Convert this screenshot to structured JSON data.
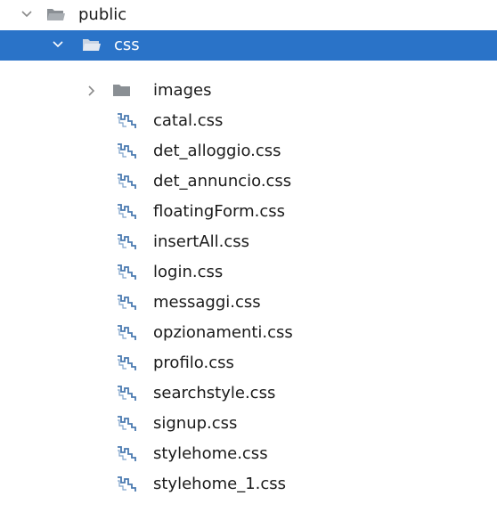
{
  "tree": {
    "public": {
      "label": "public",
      "icon": "folder-open-icon",
      "expanded": true
    },
    "css": {
      "label": "css",
      "icon": "folder-open-icon",
      "expanded": true,
      "selected": true
    },
    "images": {
      "label": "images",
      "icon": "folder-icon",
      "expanded": false
    },
    "files": [
      {
        "label": "catal.css",
        "icon": "css-file-icon"
      },
      {
        "label": "det_alloggio.css",
        "icon": "css-file-icon"
      },
      {
        "label": "det_annuncio.css",
        "icon": "css-file-icon"
      },
      {
        "label": "floatingForm.css",
        "icon": "css-file-icon"
      },
      {
        "label": "insertAll.css",
        "icon": "css-file-icon"
      },
      {
        "label": "login.css",
        "icon": "css-file-icon"
      },
      {
        "label": "messaggi.css",
        "icon": "css-file-icon"
      },
      {
        "label": "opzionamenti.css",
        "icon": "css-file-icon"
      },
      {
        "label": "profilo.css",
        "icon": "css-file-icon"
      },
      {
        "label": "searchstyle.css",
        "icon": "css-file-icon"
      },
      {
        "label": "signup.css",
        "icon": "css-file-icon"
      },
      {
        "label": "stylehome.css",
        "icon": "css-file-icon"
      },
      {
        "label": "stylehome_1.css",
        "icon": "css-file-icon"
      }
    ]
  },
  "colors": {
    "selection": "#2a73c8",
    "folder": "#8a8f94",
    "css_icon": "#4a7ab0",
    "arrow": "#777777"
  }
}
